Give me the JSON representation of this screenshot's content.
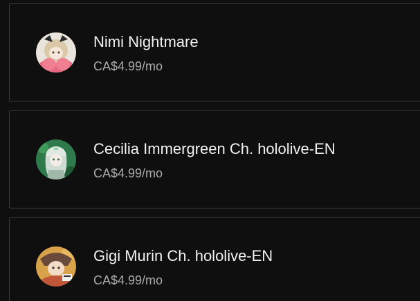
{
  "memberships": [
    {
      "name": "Nimi Nightmare",
      "price": "CA$4.99/mo",
      "avatar_icon": "nimi-avatar"
    },
    {
      "name": "Cecilia Immergreen Ch. hololive-EN",
      "price": "CA$4.99/mo",
      "avatar_icon": "cecilia-avatar"
    },
    {
      "name": "Gigi Murin Ch. hololive-EN",
      "price": "CA$4.99/mo",
      "avatar_icon": "gigi-avatar"
    }
  ],
  "colors": {
    "background": "#0f0f0f",
    "card_border": "#3a3a3a",
    "name_text": "#f1f1f1",
    "price_text": "#aaaaaa"
  }
}
